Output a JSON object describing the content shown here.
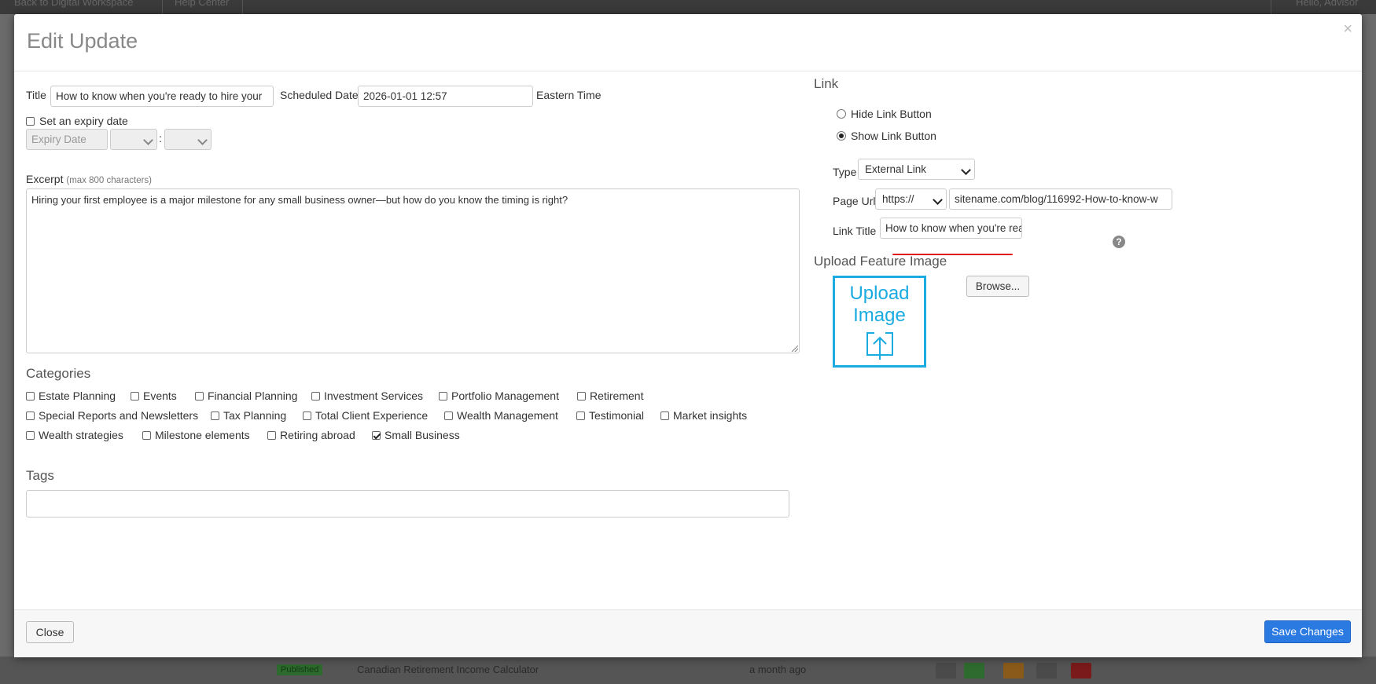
{
  "background": {
    "top_links": [
      "Back to Digital Workspace",
      "Help Center"
    ],
    "top_right": "Hello, Advisor",
    "row": {
      "status": "Published",
      "title": "Canadian Retirement Income Calculator",
      "time": "a month ago"
    }
  },
  "modal": {
    "title": "Edit Update",
    "close_symbol": "×"
  },
  "form": {
    "title_label": "Title",
    "title_value": "How to know when you're ready to hire your",
    "scheduled_label": "Scheduled Date",
    "scheduled_value": "2026-01-01 12:57",
    "timezone": "Eastern Time",
    "expiry_checkbox_label": "Set an expiry date",
    "expiry_checked": false,
    "expiry_placeholder": "Expiry Date",
    "time_separator": ":",
    "excerpt_label": "Excerpt",
    "excerpt_hint": "(max 800 characters)",
    "excerpt_value": "Hiring your first employee is a major milestone for any small business owner—but how do you know the timing is right?"
  },
  "categories": {
    "heading": "Categories",
    "items": [
      {
        "label": "Estate Planning",
        "checked": false
      },
      {
        "label": "Events",
        "checked": false
      },
      {
        "label": "Financial Planning",
        "checked": false
      },
      {
        "label": "Investment Services",
        "checked": false
      },
      {
        "label": "Portfolio Management",
        "checked": false
      },
      {
        "label": "Retirement",
        "checked": false
      },
      {
        "label": "Special Reports and Newsletters",
        "checked": false
      },
      {
        "label": "Tax Planning",
        "checked": false
      },
      {
        "label": "Total Client Experience",
        "checked": false
      },
      {
        "label": "Wealth Management",
        "checked": false
      },
      {
        "label": "Testimonial",
        "checked": false
      },
      {
        "label": "Market insights",
        "checked": false
      },
      {
        "label": "Wealth strategies",
        "checked": false
      },
      {
        "label": "Milestone elements",
        "checked": false
      },
      {
        "label": "Retiring abroad",
        "checked": false
      },
      {
        "label": "Small Business",
        "checked": true
      }
    ]
  },
  "tags": {
    "heading": "Tags",
    "value": ""
  },
  "link": {
    "heading": "Link",
    "hide_label": "Hide Link Button",
    "show_label": "Show Link Button",
    "selected": "show",
    "type_label": "Type",
    "type_value": "External Link",
    "page_url_label": "Page Url",
    "protocol_value": "https://",
    "url_value": "sitename.com/blog/116992-How-to-know-w",
    "link_title_label": "Link Title",
    "link_title_value": "How to know when you're ready to hire your",
    "help_symbol": "?"
  },
  "upload": {
    "heading": "Upload Feature Image",
    "box_line1": "Upload",
    "box_line2": "Image",
    "browse_label": "Browse..."
  },
  "footer": {
    "close_label": "Close",
    "save_label": "Save Changes"
  },
  "colors": {
    "primary": "#2a7ae2",
    "upload_accent": "#1aabe0",
    "spellcheck_underline": "#e01e1e"
  }
}
